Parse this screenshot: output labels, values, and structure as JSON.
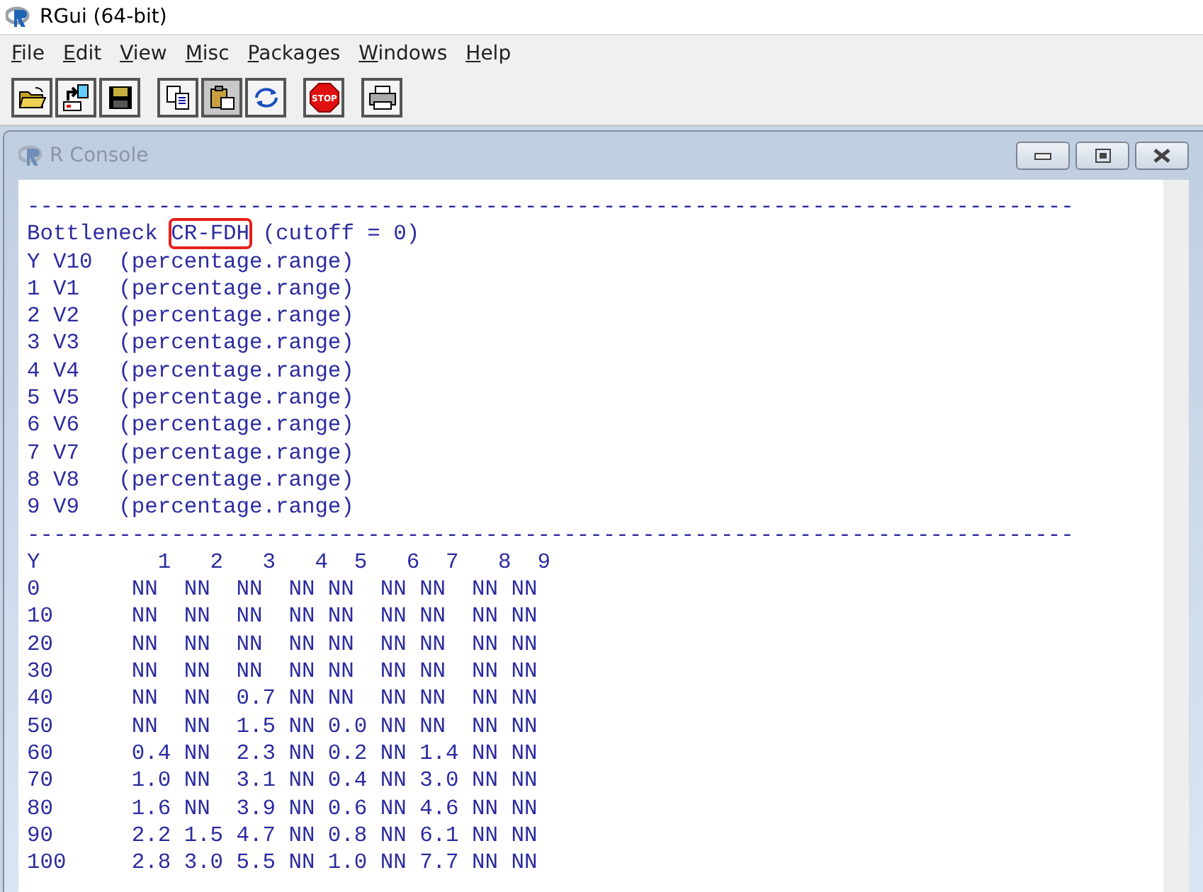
{
  "window": {
    "title": "RGui (64-bit)"
  },
  "menu": [
    "File",
    "Edit",
    "View",
    "Misc",
    "Packages",
    "Windows",
    "Help"
  ],
  "toolbar": [
    {
      "kind": "open"
    },
    {
      "kind": "load"
    },
    {
      "kind": "save"
    },
    {
      "kind": "gap"
    },
    {
      "kind": "copy"
    },
    {
      "kind": "paste"
    },
    {
      "kind": "copy-paste"
    },
    {
      "kind": "gap"
    },
    {
      "kind": "stop",
      "label": "STOP"
    },
    {
      "kind": "gap"
    },
    {
      "kind": "print"
    }
  ],
  "console": {
    "title": "R Console",
    "lines": [
      {
        "kind": "rule",
        "text": "--------------------------------------------------------------------------------"
      },
      {
        "kind": "highlighted",
        "before": "Bottleneck",
        "highlight": "CR-FDH",
        "after": "(cutoff = 0)"
      },
      {
        "kind": "text",
        "text": "Y V10  (percentage.range)"
      },
      {
        "kind": "text",
        "text": "1 V1   (percentage.range)"
      },
      {
        "kind": "text",
        "text": "2 V2   (percentage.range)"
      },
      {
        "kind": "text",
        "text": "3 V3   (percentage.range)"
      },
      {
        "kind": "text",
        "text": "4 V4   (percentage.range)"
      },
      {
        "kind": "text",
        "text": "5 V5   (percentage.range)"
      },
      {
        "kind": "text",
        "text": "6 V6   (percentage.range)"
      },
      {
        "kind": "text",
        "text": "7 V7   (percentage.range)"
      },
      {
        "kind": "text",
        "text": "8 V8   (percentage.range)"
      },
      {
        "kind": "text",
        "text": "9 V9   (percentage.range)"
      },
      {
        "kind": "rule",
        "text": "--------------------------------------------------------------------------------"
      },
      {
        "kind": "text",
        "text": "Y         1   2   3   4  5   6  7   8  9"
      },
      {
        "kind": "text",
        "text": "0       NN  NN  NN  NN NN  NN NN  NN NN"
      },
      {
        "kind": "text",
        "text": "10      NN  NN  NN  NN NN  NN NN  NN NN"
      },
      {
        "kind": "text",
        "text": "20      NN  NN  NN  NN NN  NN NN  NN NN"
      },
      {
        "kind": "text",
        "text": "30      NN  NN  NN  NN NN  NN NN  NN NN"
      },
      {
        "kind": "text",
        "text": "40      NN  NN  0.7 NN NN  NN NN  NN NN"
      },
      {
        "kind": "text",
        "text": "50      NN  NN  1.5 NN 0.0 NN NN  NN NN"
      },
      {
        "kind": "text",
        "text": "60      0.4 NN  2.3 NN 0.2 NN 1.4 NN NN"
      },
      {
        "kind": "text",
        "text": "70      1.0 NN  3.1 NN 0.4 NN 3.0 NN NN"
      },
      {
        "kind": "text",
        "text": "80      1.6 NN  3.9 NN 0.6 NN 4.6 NN NN"
      },
      {
        "kind": "text",
        "text": "90      2.2 1.5 4.7 NN 0.8 NN 6.1 NN NN"
      },
      {
        "kind": "text",
        "text": "100     2.8 3.0 5.5 NN 1.0 NN 7.7 NN NN"
      }
    ]
  }
}
